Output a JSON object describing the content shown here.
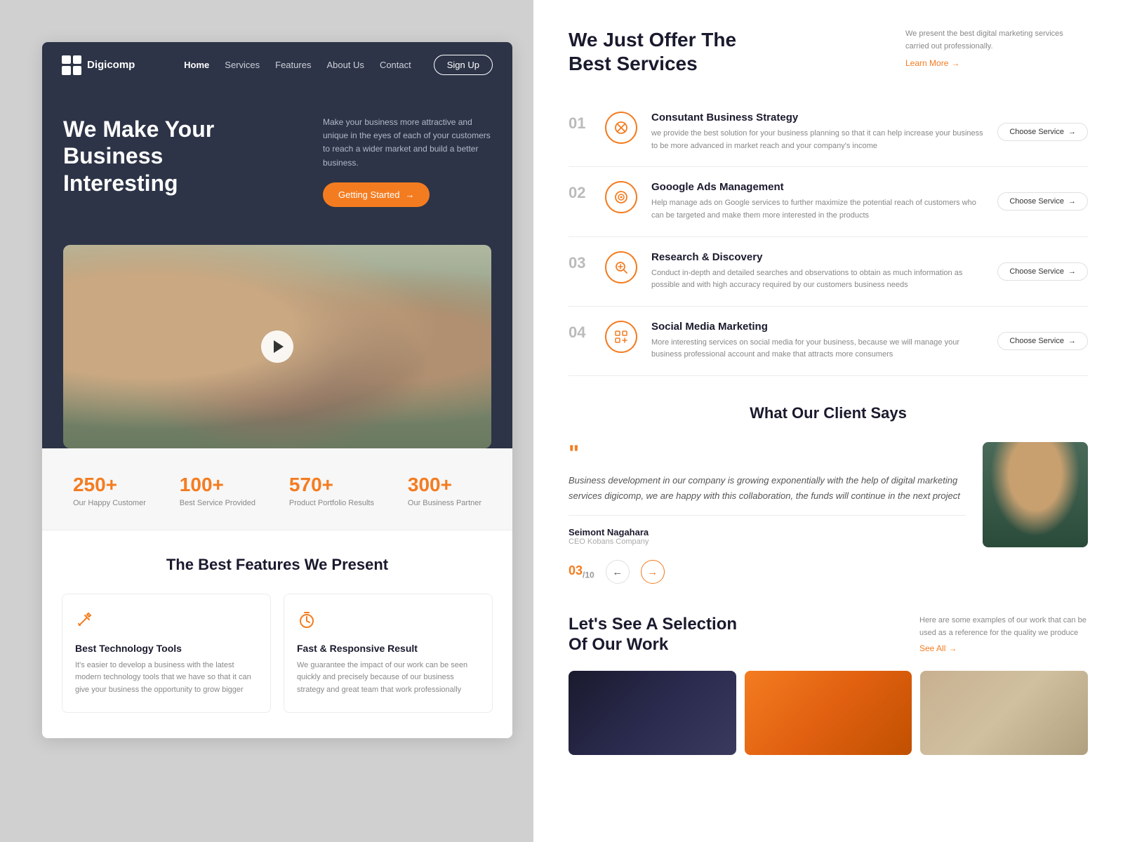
{
  "left": {
    "nav": {
      "logo": "Digicomp",
      "links": [
        "Home",
        "Services",
        "Features",
        "About Us",
        "Contact"
      ],
      "active_link": "Home",
      "cta_label": "Sign Up"
    },
    "hero": {
      "title": "We Make Your Business Interesting",
      "description": "Make your business more attractive and unique in the eyes of each of your customers to reach a wider market and build a better business.",
      "cta_label": "Getting Started"
    },
    "stats": [
      {
        "num": "250+",
        "label": "Our Happy Customer"
      },
      {
        "num": "100+",
        "label": "Best Service Provided"
      },
      {
        "num": "570+",
        "label": "Product Portfolio Results"
      },
      {
        "num": "300+",
        "label": "Our Business Partner"
      }
    ],
    "features_title": "The Best Features We Present",
    "features": [
      {
        "icon": "🔧",
        "name": "Best Technology Tools",
        "desc": "It's easier to develop a business with the latest modern technology tools that we have so that it can give your business the opportunity to grow bigger"
      },
      {
        "icon": "⏱",
        "name": "Fast & Responsive Result",
        "desc": "We guarantee the impact of our work can be seen quickly and precisely because of our business strategy and great team that work professionally"
      }
    ]
  },
  "right": {
    "services": {
      "title": "We Just Offer The Best Services",
      "description": "We present the best digital marketing services carried out professionally.",
      "learn_more": "Learn More",
      "items": [
        {
          "num": "01",
          "icon": "✕⊙",
          "icon_type": "consultant",
          "name": "Consutant Business Strategy",
          "desc": "we provide the best solution for your business planning so that it can help increase your business to be more advanced in market reach and your company's income",
          "cta": "Choose Service"
        },
        {
          "num": "02",
          "icon": "◎",
          "icon_type": "google-ads",
          "name": "Gooogle Ads Management",
          "desc": "Help manage ads on Google services to further maximize the potential reach of customers who can be targeted and make them more interested in the products",
          "cta": "Choose Service"
        },
        {
          "num": "03",
          "icon": "🔍+",
          "icon_type": "research",
          "name": "Research & Discovery",
          "desc": "Conduct in-depth and detailed searches and observations to obtain as much information as possible and with high accuracy required by our customers business needs",
          "cta": "Choose Service"
        },
        {
          "num": "04",
          "icon": "⊞",
          "icon_type": "social",
          "name": "Social Media Marketing",
          "desc": "More interesting services on social media for your business, because we will manage your business professional account and make that attracts more consumers",
          "cta": "Choose Service"
        }
      ]
    },
    "testimonials": {
      "title": "What Our Client Says",
      "quote": "Business development in our company is growing exponentially with the help of digital marketing services digicomp, we are happy with this collaboration, the funds will continue in the next project",
      "author_name": "Seimont Nagahara",
      "author_role": "CEO Kobans Company",
      "current": "03",
      "total": "10",
      "prev_label": "←",
      "next_label": "→"
    },
    "portfolio": {
      "title": "Let's See A Selection Of Our Work",
      "description": "Here are some examples of our work that can be used as a reference for the quality we produce",
      "see_all": "See All"
    }
  }
}
